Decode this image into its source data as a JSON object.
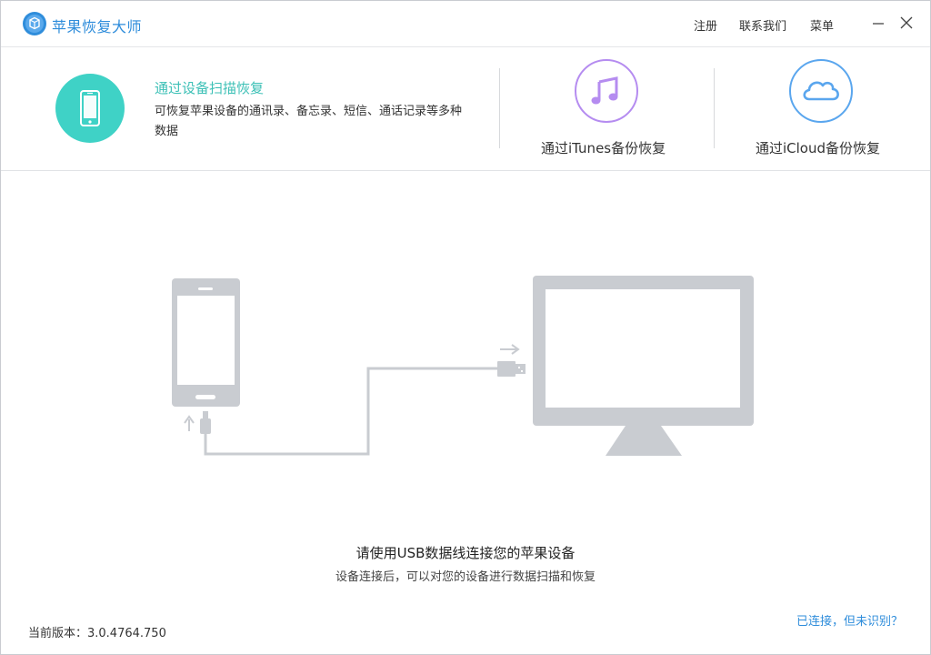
{
  "app": {
    "title": "苹果恢复大师"
  },
  "top_menu": {
    "register": "注册",
    "contact": "联系我们",
    "menu": "菜单"
  },
  "modes": {
    "device": {
      "title": "通过设备扫描恢复",
      "description": "可恢复苹果设备的通讯录、备忘录、短信、通话记录等多种数据",
      "icon": "phone-icon",
      "active": true
    },
    "itunes": {
      "label": "通过iTunes备份恢复",
      "icon": "music-note-icon"
    },
    "icloud": {
      "label": "通过iCloud备份恢复",
      "icon": "cloud-icon"
    }
  },
  "connect_hint": {
    "main": "请使用USB数据线连接您的苹果设备",
    "sub": "设备连接后，可以对您的设备进行数据扫描和恢复"
  },
  "footer": {
    "version": "当前版本：3.0.4764.750",
    "status_link": "已连接，但未识别？"
  },
  "colors": {
    "accent_blue": "#2f8ddb",
    "teal": "#3fd2c6",
    "itunes_purple": "#b58cf0",
    "icloud_blue": "#5aa6ee",
    "illustration_gray": "#c9ccd1"
  }
}
